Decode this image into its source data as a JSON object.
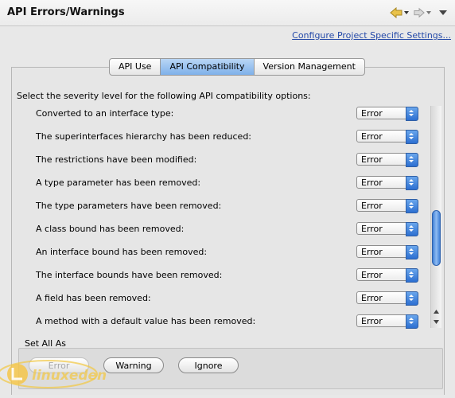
{
  "header": {
    "title": "API Errors/Warnings"
  },
  "config_link": "Configure Project Specific Settings...",
  "tabs": [
    {
      "label": "API Use"
    },
    {
      "label": "API Compatibility"
    },
    {
      "label": "Version Management"
    }
  ],
  "instructions": "Select the severity level for the following API compatibility options:",
  "options": [
    {
      "label": "Converted to an interface type:",
      "value": "Error"
    },
    {
      "label": "The superinterfaces hierarchy has been reduced:",
      "value": "Error"
    },
    {
      "label": "The restrictions have been modified:",
      "value": "Error"
    },
    {
      "label": "A type parameter has been removed:",
      "value": "Error"
    },
    {
      "label": "The type parameters have been removed:",
      "value": "Error"
    },
    {
      "label": "A class bound has been removed:",
      "value": "Error"
    },
    {
      "label": "An interface bound has been removed:",
      "value": "Error"
    },
    {
      "label": "The interface bounds have been removed:",
      "value": "Error"
    },
    {
      "label": "A field has been removed:",
      "value": "Error"
    },
    {
      "label": "A method with a default value has been removed:",
      "value": "Error"
    }
  ],
  "set_all": {
    "label": "Set All As",
    "buttons": [
      {
        "label": "Error"
      },
      {
        "label": "Warning"
      },
      {
        "label": "Ignore"
      }
    ]
  },
  "watermark": "linuxeden"
}
